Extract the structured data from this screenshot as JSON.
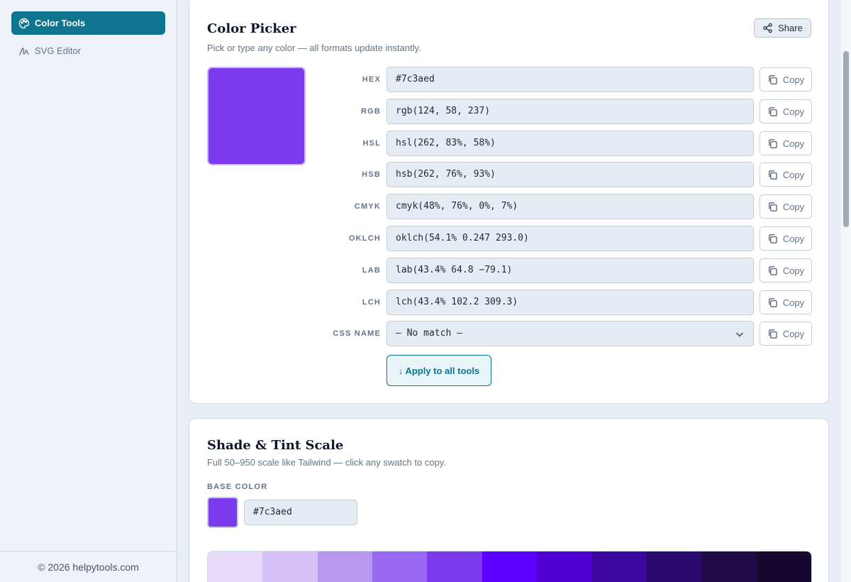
{
  "sidebar": {
    "items": [
      {
        "label": "Color Tools",
        "icon": "palette-icon"
      },
      {
        "label": "SVG Editor",
        "icon": "squiggle-icon"
      }
    ],
    "footer": "© 2026 helpytools.com"
  },
  "picker": {
    "title": "Color Picker",
    "subtitle": "Pick or type any color — all formats update instantly.",
    "share_label": "Share",
    "swatch_color": "#7c3aed",
    "copy_label": "Copy",
    "formats": [
      {
        "label": "HEX",
        "value": "#7c3aed"
      },
      {
        "label": "RGB",
        "value": "rgb(124, 58, 237)"
      },
      {
        "label": "HSL",
        "value": "hsl(262, 83%, 58%)"
      },
      {
        "label": "HSB",
        "value": "hsb(262, 76%, 93%)"
      },
      {
        "label": "CMYK",
        "value": "cmyk(48%, 76%, 0%, 7%)"
      },
      {
        "label": "OKLCH",
        "value": "oklch(54.1% 0.247 293.0)"
      },
      {
        "label": "LAB",
        "value": "lab(43.4% 64.8 −79.1)"
      },
      {
        "label": "LCH",
        "value": "lch(43.4% 102.2 309.3)"
      }
    ],
    "css_name": {
      "label": "CSS NAME",
      "value": "— No match —"
    },
    "apply_label": "↓ Apply to all tools"
  },
  "shade": {
    "title": "Shade & Tint Scale",
    "subtitle": "Full 50–950 scale like Tailwind — click any swatch to copy.",
    "base_label": "BASE COLOR",
    "base_value": "#7c3aed",
    "base_color": "#7c3aed",
    "scale_colors": [
      "#e7dbf9",
      "#d4c1f6",
      "#b797f0",
      "#9a69f1",
      "#7c3aed",
      "#5e00ff",
      "#4d00cf",
      "#3b079e",
      "#2a0a6e",
      "#1e0b47",
      "#150a2e"
    ]
  },
  "colors": {
    "accent": "#0f7490",
    "swatch": "#7c3aed"
  }
}
